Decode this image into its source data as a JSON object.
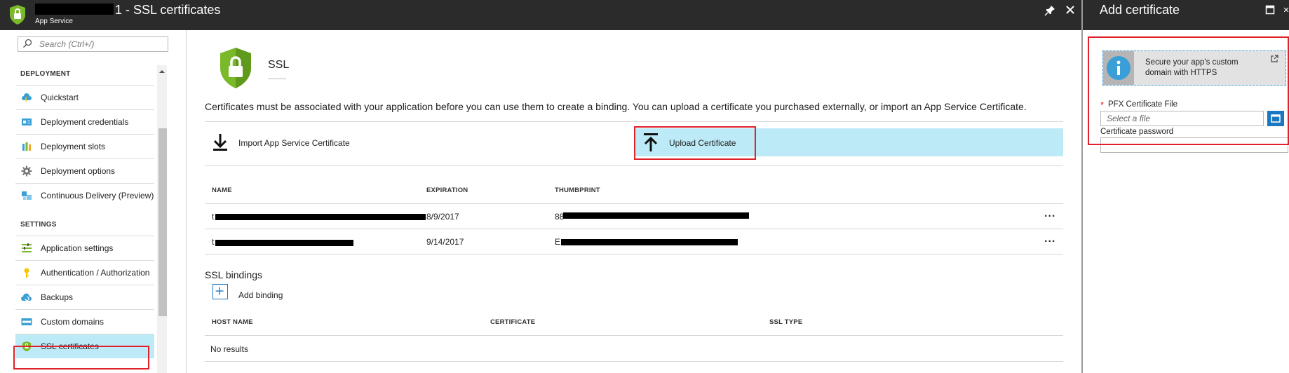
{
  "colors": {
    "header_bg": "#2b2b2b",
    "selected_bg": "#bdeaf7",
    "highlight_border": "#e0202a",
    "accent_blue": "#1a78c2",
    "shield_green": "#7ab929"
  },
  "header": {
    "title_suffix": "1 - SSL certificates",
    "subtitle": "App Service"
  },
  "search": {
    "placeholder": "Search (Ctrl+/)"
  },
  "sidebar": {
    "sections": [
      {
        "label": "DEPLOYMENT",
        "items": [
          {
            "label": "Quickstart",
            "icon": "cloud-lightning-icon"
          },
          {
            "label": "Deployment credentials",
            "icon": "credentials-icon"
          },
          {
            "label": "Deployment slots",
            "icon": "slots-icon"
          },
          {
            "label": "Deployment options",
            "icon": "gear-icon"
          },
          {
            "label": "Continuous Delivery (Preview)",
            "icon": "cubes-icon"
          }
        ]
      },
      {
        "label": "SETTINGS",
        "items": [
          {
            "label": "Application settings",
            "icon": "settings-list-icon"
          },
          {
            "label": "Authentication / Authorization",
            "icon": "key-icon"
          },
          {
            "label": "Backups",
            "icon": "cloud-backup-icon"
          },
          {
            "label": "Custom domains",
            "icon": "www-icon"
          },
          {
            "label": "SSL certificates",
            "icon": "shield-icon",
            "selected": true
          }
        ]
      }
    ]
  },
  "main": {
    "title": "SSL",
    "description": "Certificates must be associated with your application before you can use them to create a binding. You can upload a certificate you purchased externally, or import an App Service Certificate.",
    "actions": {
      "import_label": "Import App Service Certificate",
      "upload_label": "Upload Certificate"
    },
    "certificates": {
      "columns": [
        "NAME",
        "EXPIRATION",
        "THUMBPRINT"
      ],
      "rows": [
        {
          "name_prefix": "t",
          "expiration": "8/9/2017",
          "thumb_prefix": "88"
        },
        {
          "name_prefix": "t",
          "expiration": "9/14/2017",
          "thumb_prefix": "E"
        }
      ],
      "more_label": "..."
    },
    "bindings": {
      "title": "SSL bindings",
      "add_label": "Add binding",
      "columns": [
        "HOST NAME",
        "CERTIFICATE",
        "SSL TYPE"
      ],
      "empty_text": "No results"
    }
  },
  "add_certificate": {
    "title": "Add certificate",
    "info_text": "Secure your app's custom domain with HTTPS",
    "pfx_label": "PFX Certificate File",
    "pfx_placeholder": "Select a file",
    "password_label": "Certificate password",
    "password_value": ""
  }
}
